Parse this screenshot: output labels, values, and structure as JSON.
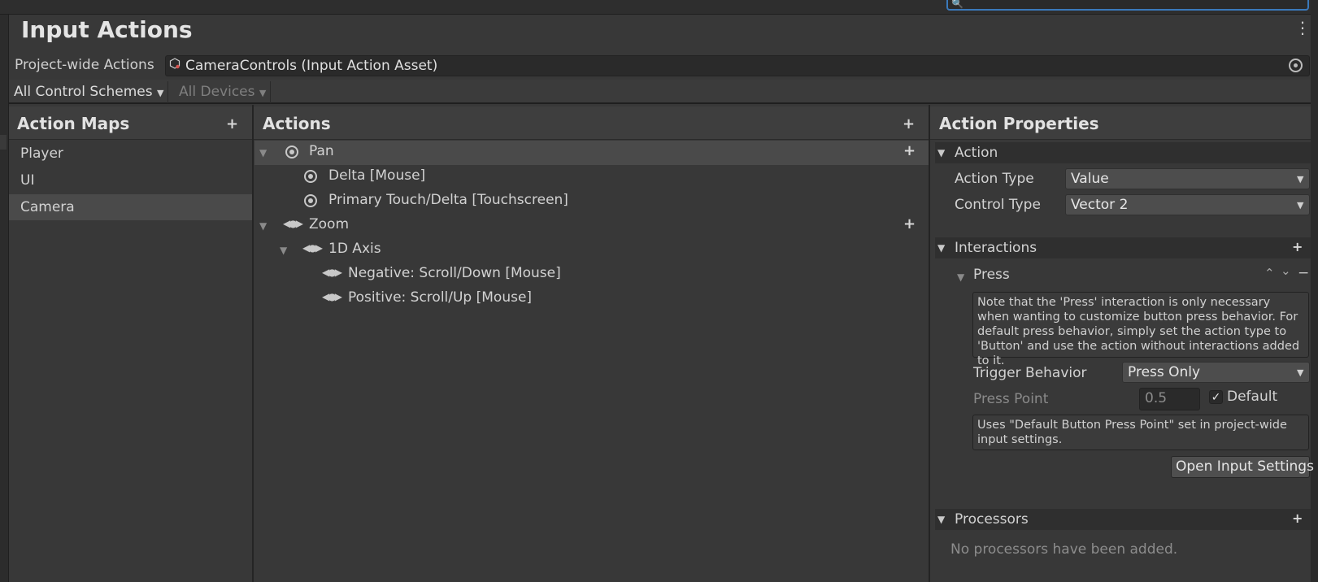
{
  "window": {
    "title": "Input Actions"
  },
  "project_wide": {
    "label": "Project-wide Actions",
    "asset": "CameraControls (Input Action Asset)"
  },
  "toolbar": {
    "control_schemes": "All Control Schemes",
    "devices": "All Devices"
  },
  "action_maps": {
    "header": "Action Maps",
    "add": "+",
    "items": [
      {
        "label": "Player"
      },
      {
        "label": "UI"
      },
      {
        "label": "Camera"
      }
    ]
  },
  "actions": {
    "header": "Actions",
    "add": "+",
    "add_binding": "+",
    "rows": [
      {
        "label": "Pan"
      },
      {
        "label": "Delta [Mouse]"
      },
      {
        "label": "Primary Touch/Delta [Touchscreen]"
      },
      {
        "label": "Zoom"
      },
      {
        "label": "1D Axis"
      },
      {
        "label": "Negative: Scroll/Down [Mouse]"
      },
      {
        "label": "Positive: Scroll/Up [Mouse]"
      }
    ]
  },
  "properties": {
    "header": "Action Properties",
    "action_section": "Action",
    "action_type_label": "Action Type",
    "action_type_value": "Value",
    "control_type_label": "Control Type",
    "control_type_value": "Vector 2",
    "interactions_section": "Interactions",
    "add": "+",
    "press": {
      "title": "Press",
      "up": "⌃",
      "down": "⌄",
      "remove": "−",
      "note": "Note that the 'Press' interaction is only necessary when wanting to customize button press behavior. For default press behavior, simply set the action type to 'Button' and use the action without interactions added to it.",
      "trigger_label": "Trigger Behavior",
      "trigger_value": "Press Only",
      "press_point_label": "Press Point",
      "press_point_value": "0.5",
      "default_label": "Default",
      "default_note": "Uses \"Default Button Press Point\" set in project-wide input settings.",
      "open_settings": "Open Input Settings"
    },
    "processors_section": "Processors",
    "processors_empty": "No processors have been added."
  }
}
